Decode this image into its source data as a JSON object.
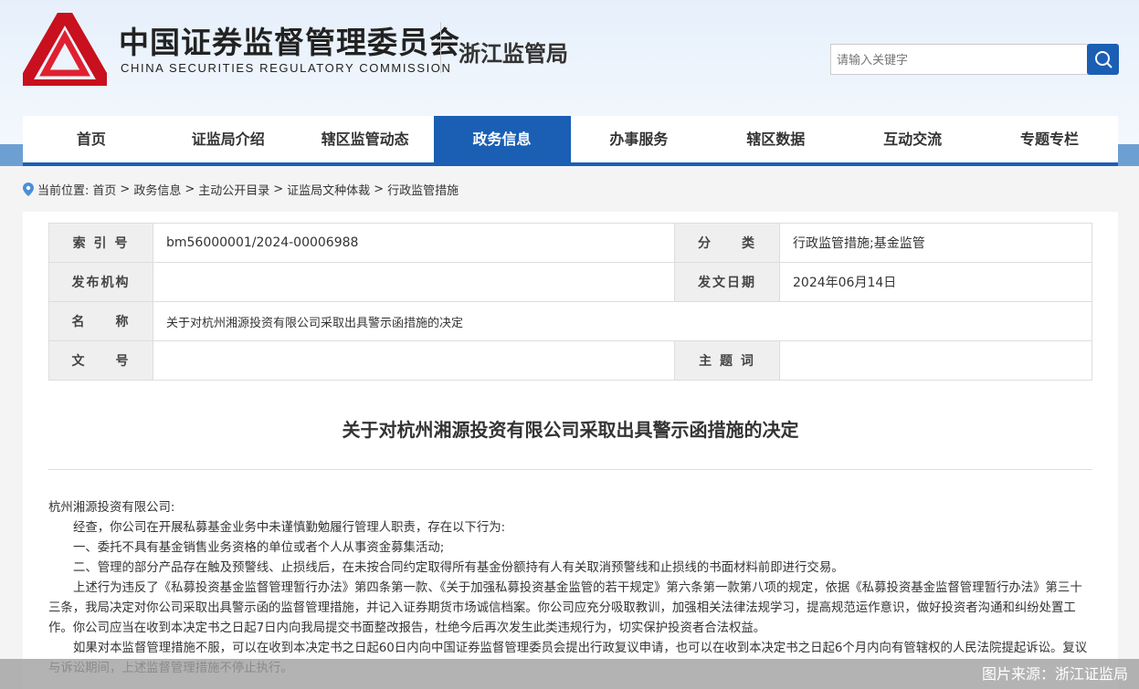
{
  "header": {
    "org_cn": "中国证券监督管理委员会",
    "org_en": "CHINA SECURITIES REGULATORY COMMISSION",
    "bureau": "浙江监管局",
    "search_placeholder": "请输入关键字"
  },
  "nav": [
    {
      "label": "首页"
    },
    {
      "label": "证监局介绍"
    },
    {
      "label": "辖区监管动态"
    },
    {
      "label": "政务信息",
      "active": true
    },
    {
      "label": "办事服务"
    },
    {
      "label": "辖区数据"
    },
    {
      "label": "互动交流"
    },
    {
      "label": "专题专栏"
    }
  ],
  "breadcrumb": {
    "prefix": "当前位置:",
    "items": [
      "首页",
      "政务信息",
      "主动公开目录",
      "证监局文种体裁",
      "行政监管措施"
    ],
    "sep": ">"
  },
  "meta": {
    "index_label": "索 引 号",
    "index": "bm56000001/2024-00006988",
    "cat_label": "分　　类",
    "cat": "行政监管措施;基金监管",
    "issuer_label": "发布机构",
    "issuer": "",
    "date_label": "发文日期",
    "date": "2024年06月14日",
    "name_label": "名　　称",
    "name": "关于对杭州湘源投资有限公司采取出具警示函措施的决定",
    "docno_label": "文　　号",
    "docno": "",
    "subject_label": "主 题 词",
    "subject": ""
  },
  "article": {
    "title": "关于对杭州湘源投资有限公司采取出具警示函措施的决定",
    "paragraphs": [
      "杭州湘源投资有限公司:",
      "经查，你公司在开展私募基金业务中未谨慎勤勉履行管理人职责，存在以下行为:",
      "一、委托不具有基金销售业务资格的单位或者个人从事资金募集活动;",
      "二、管理的部分产品存在触及预警线、止损线后，在未按合同约定取得所有基金份额持有人有关取消预警线和止损线的书面材料前即进行交易。",
      "上述行为违反了《私募投资基金监督管理暂行办法》第四条第一款、《关于加强私募投资基金监管的若干规定》第六条第一款第八项的规定，依据《私募投资基金监督管理暂行办法》第三十三条，我局决定对你公司采取出具警示函的监督管理措施，并记入证券期货市场诚信档案。你公司应充分吸取教训，加强相关法律法规学习，提高规范运作意识，做好投资者沟通和纠纷处置工作。你公司应当在收到本决定书之日起7日内向我局提交书面整改报告，杜绝今后再次发生此类违规行为，切实保护投资者合法权益。",
      "如果对本监督管理措施不服，可以在收到本决定书之日起60日内向中国证券监督管理委员会提出行政复议申请，也可以在收到本决定书之日起6个月内向有管辖权的人民法院提起诉讼。复议与诉讼期间，上述监督管理措施不停止执行。"
    ]
  },
  "overlay": {
    "caption": "图片来源：浙江证监局"
  }
}
